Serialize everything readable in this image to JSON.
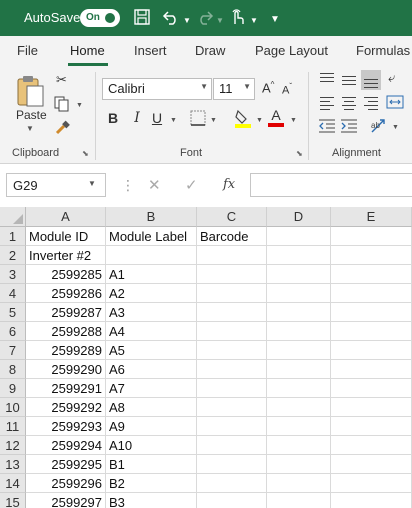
{
  "titlebar": {
    "autosave_label": "AutoSave",
    "autosave_state": "On",
    "icons": [
      "save-icon",
      "undo-icon",
      "redo-icon",
      "touch-mode-icon",
      "customize-icon"
    ]
  },
  "tabs": [
    "File",
    "Home",
    "Insert",
    "Draw",
    "Page Layout",
    "Formulas"
  ],
  "active_tab": "Home",
  "ribbon": {
    "clipboard": {
      "label": "Clipboard",
      "paste_label": "Paste"
    },
    "font": {
      "label": "Font",
      "name": "Calibri",
      "size": "11",
      "bold": "B",
      "italic": "I",
      "underline": "U",
      "font_color_glyph": "A"
    },
    "alignment": {
      "label": "Alignment"
    }
  },
  "formula_bar": {
    "name_box": "G29",
    "fx": "fx",
    "formula": ""
  },
  "sheet": {
    "columns": [
      "A",
      "B",
      "C",
      "D",
      "E"
    ],
    "rows": [
      {
        "num": "1",
        "A": "Module ID",
        "B": "Module Label",
        "C": "Barcode"
      },
      {
        "num": "2",
        "A": "Inverter #2",
        "B": "",
        "C": ""
      },
      {
        "num": "3",
        "A": "2599285",
        "B": "A1",
        "C": ""
      },
      {
        "num": "4",
        "A": "2599286",
        "B": "A2",
        "C": ""
      },
      {
        "num": "5",
        "A": "2599287",
        "B": "A3",
        "C": ""
      },
      {
        "num": "6",
        "A": "2599288",
        "B": "A4",
        "C": ""
      },
      {
        "num": "7",
        "A": "2599289",
        "B": "A5",
        "C": ""
      },
      {
        "num": "8",
        "A": "2599290",
        "B": "A6",
        "C": ""
      },
      {
        "num": "9",
        "A": "2599291",
        "B": "A7",
        "C": ""
      },
      {
        "num": "10",
        "A": "2599292",
        "B": "A8",
        "C": ""
      },
      {
        "num": "11",
        "A": "2599293",
        "B": "A9",
        "C": ""
      },
      {
        "num": "12",
        "A": "2599294",
        "B": "A10",
        "C": ""
      },
      {
        "num": "13",
        "A": "2599295",
        "B": "B1",
        "C": ""
      },
      {
        "num": "14",
        "A": "2599296",
        "B": "B2",
        "C": ""
      },
      {
        "num": "15",
        "A": "2599297",
        "B": "B3",
        "C": ""
      }
    ]
  },
  "colors": {
    "accent": "#217346",
    "ribbon_bg": "#f3f3f3",
    "highlight_yellow": "#ffff00",
    "font_red": "#e00000"
  }
}
